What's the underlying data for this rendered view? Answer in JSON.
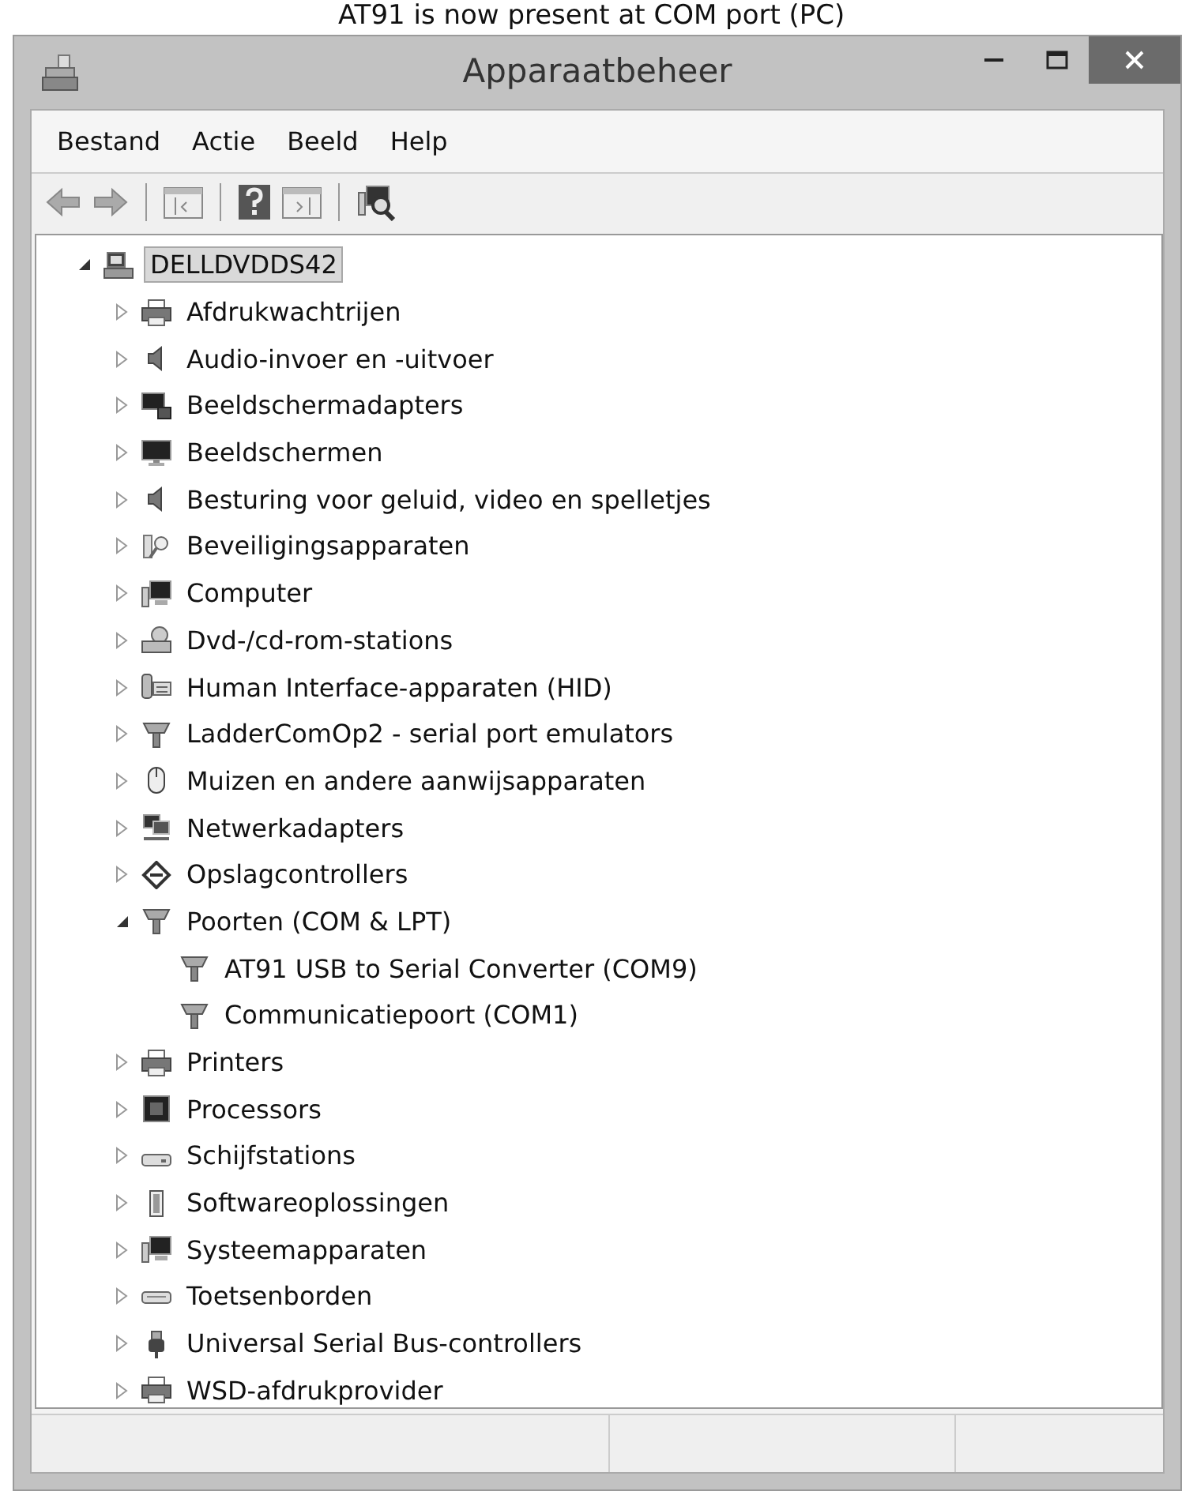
{
  "caption": "AT91 is now present at COM port (PC)",
  "window": {
    "title": "Apparaatbeheer"
  },
  "menu": [
    {
      "label": "Bestand"
    },
    {
      "label": "Actie"
    },
    {
      "label": "Beeld"
    },
    {
      "label": "Help"
    }
  ],
  "tree": [
    {
      "label": "DELLDVDDS42",
      "expanded": true,
      "selected": true,
      "children": [
        {
          "label": "Afdrukwachtrijen",
          "expanded": false
        },
        {
          "label": "Audio-invoer en -uitvoer",
          "expanded": false
        },
        {
          "label": "Beeldschermadapters",
          "expanded": false
        },
        {
          "label": "Beeldschermen",
          "expanded": false
        },
        {
          "label": "Besturing voor geluid, video en spelletjes",
          "expanded": false
        },
        {
          "label": "Beveiligingsapparaten",
          "expanded": false
        },
        {
          "label": "Computer",
          "expanded": false
        },
        {
          "label": "Dvd-/cd-rom-stations",
          "expanded": false
        },
        {
          "label": "Human Interface-apparaten (HID)",
          "expanded": false
        },
        {
          "label": "LadderComOp2 - serial port emulators",
          "expanded": false
        },
        {
          "label": "Muizen en andere aanwijsapparaten",
          "expanded": false
        },
        {
          "label": "Netwerkadapters",
          "expanded": false
        },
        {
          "label": "Opslagcontrollers",
          "expanded": false
        },
        {
          "label": "Poorten (COM & LPT)",
          "expanded": true,
          "children": [
            {
              "label": "AT91 USB to Serial Converter (COM9)"
            },
            {
              "label": "Communicatiepoort (COM1)"
            }
          ]
        },
        {
          "label": "Printers",
          "expanded": false
        },
        {
          "label": "Processors",
          "expanded": false
        },
        {
          "label": "Schijfstations",
          "expanded": false
        },
        {
          "label": "Softwareoplossingen",
          "expanded": false
        },
        {
          "label": "Systeemapparaten",
          "expanded": false
        },
        {
          "label": "Toetsenborden",
          "expanded": false
        },
        {
          "label": "Universal Serial Bus-controllers",
          "expanded": false
        },
        {
          "label": "WSD-afdrukprovider",
          "expanded": false
        }
      ]
    }
  ]
}
